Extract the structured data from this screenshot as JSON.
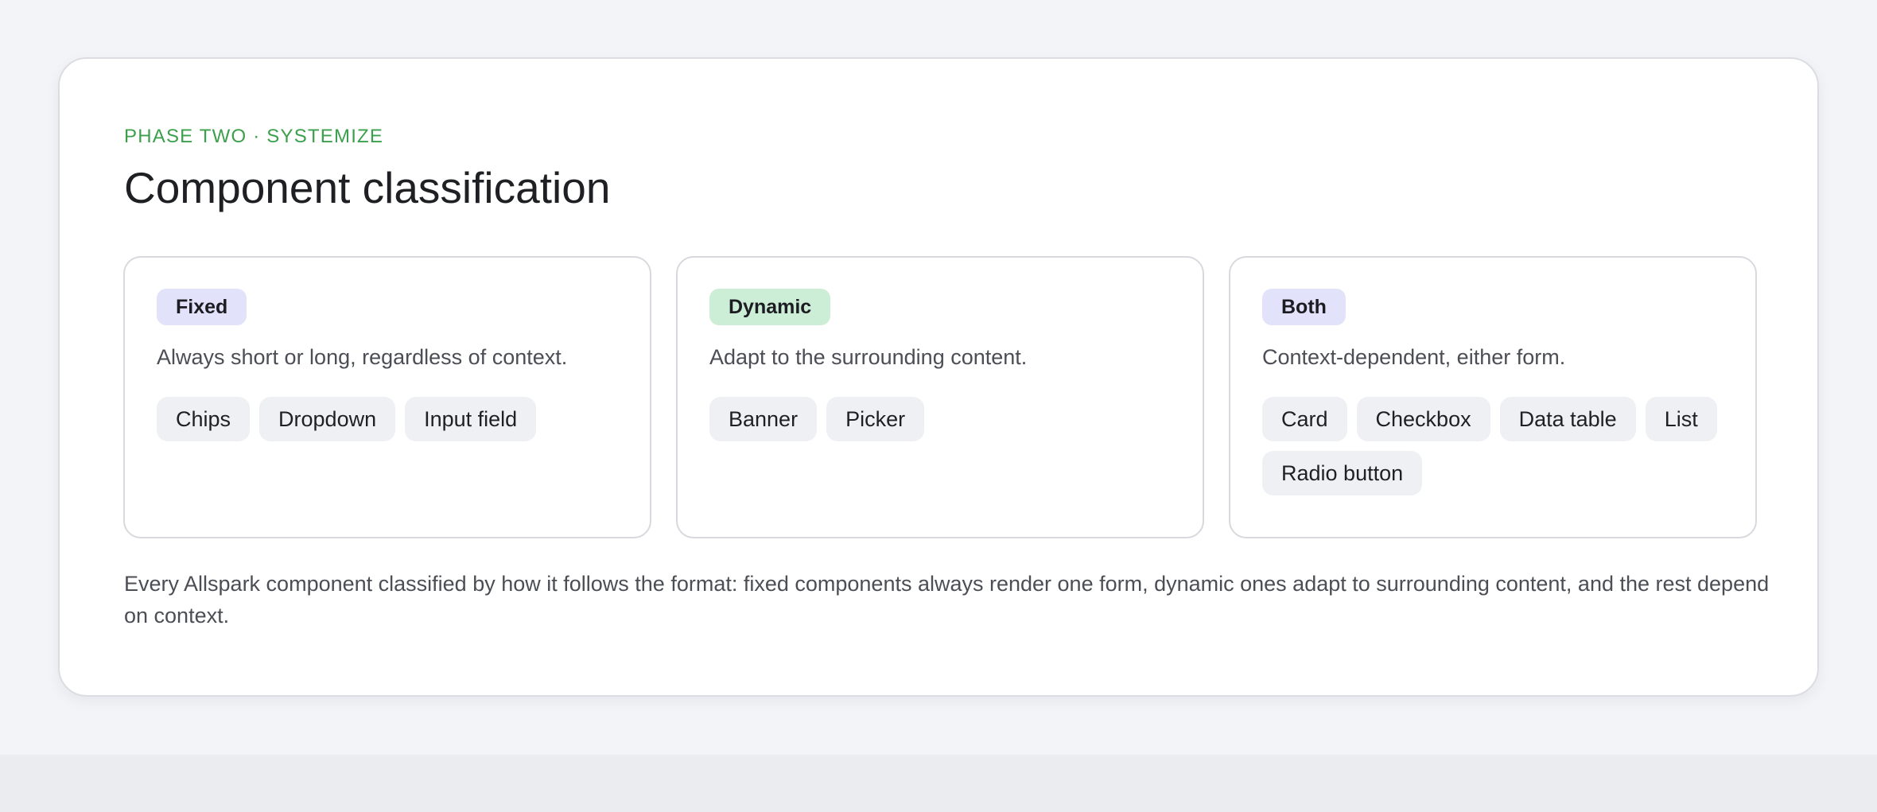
{
  "header": {
    "eyebrow": "PHASE TWO · SYSTEMIZE",
    "title": "Component classification"
  },
  "colors": {
    "accent_green": "#3b9f4c",
    "badge_purple": "#e3e2fb",
    "badge_green": "#cdeed6",
    "chip_background": "#eff0f4"
  },
  "categories": [
    {
      "label": "Fixed",
      "description": "Always short or long, regardless of context.",
      "components": [
        "Chips",
        "Dropdown",
        "Input field"
      ]
    },
    {
      "label": "Dynamic",
      "description": "Adapt to the surrounding content.",
      "components": [
        "Banner",
        "Picker"
      ]
    },
    {
      "label": "Both",
      "description": "Context-dependent, either form.",
      "components": [
        "Card",
        "Checkbox",
        "Data table",
        "List",
        "Radio button"
      ]
    }
  ],
  "caption": "Every Allspark component classified by how it follows the format: fixed components always render one form, dynamic ones adapt to surrounding content, and the rest depend on context."
}
